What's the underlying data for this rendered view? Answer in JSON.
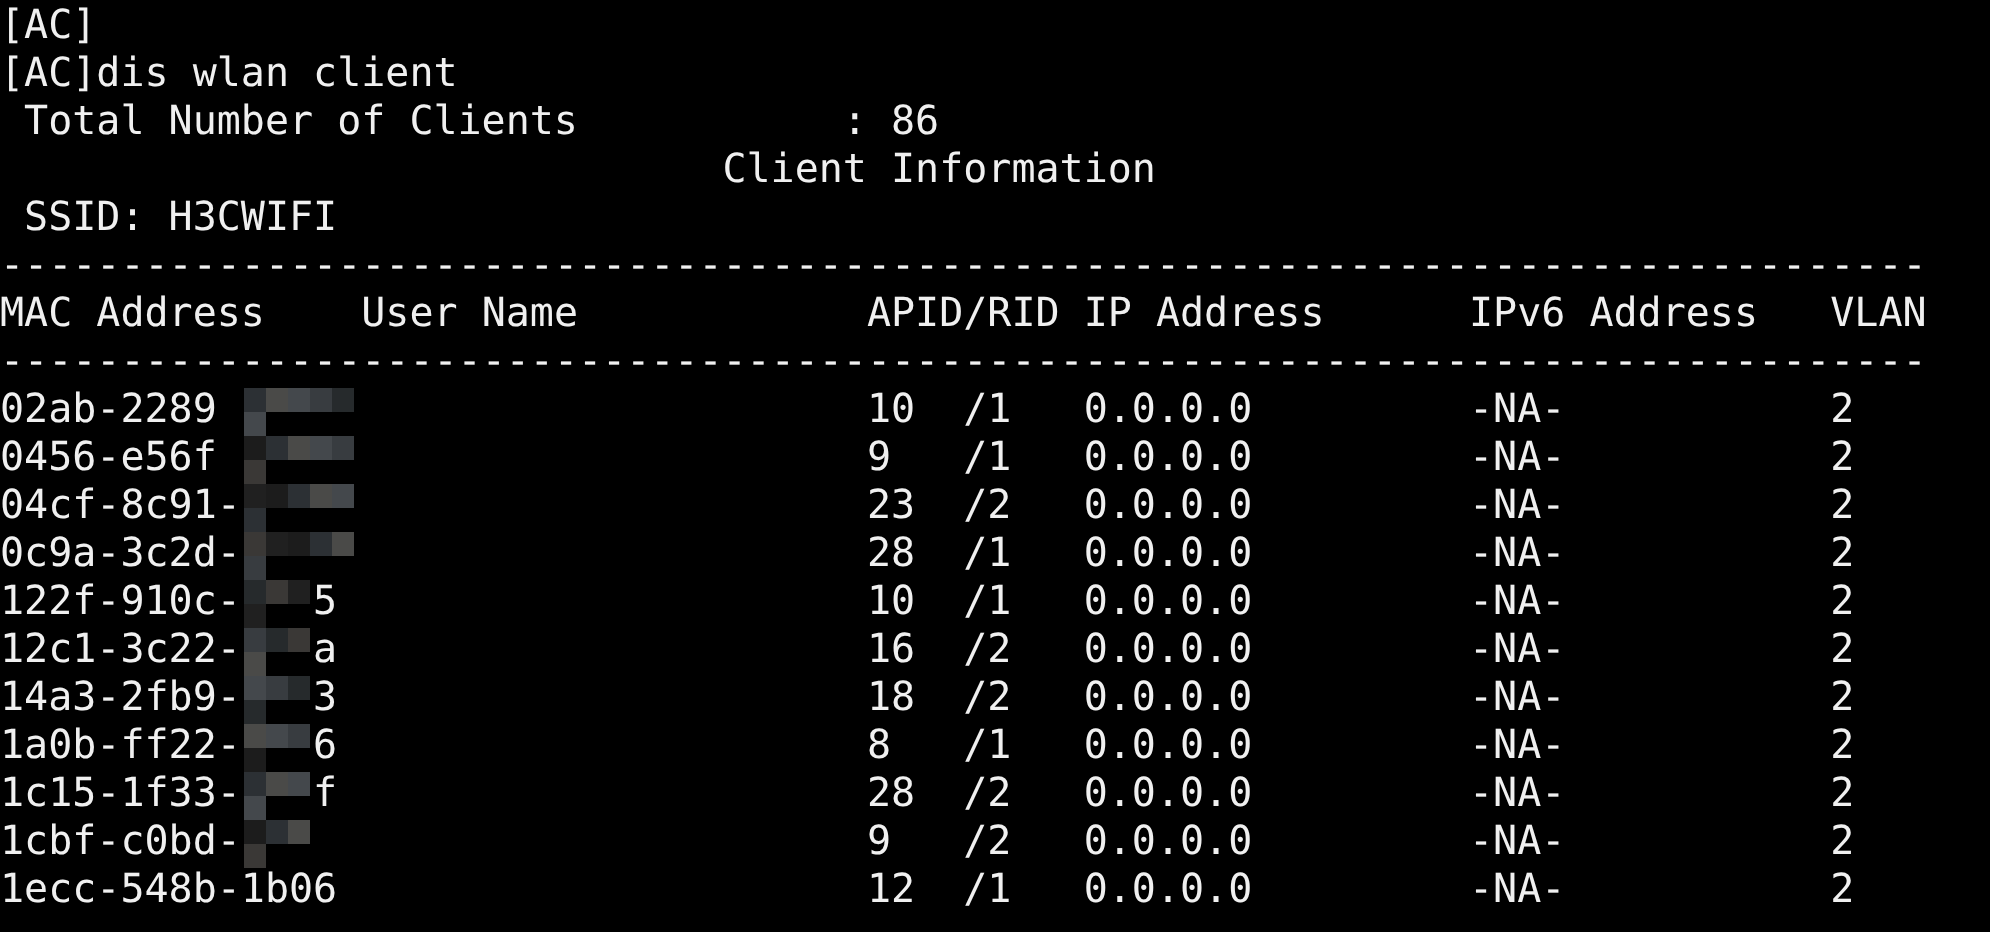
{
  "prompt_lines": [
    "[AC]",
    "[AC]dis wlan client"
  ],
  "total": {
    "label": "Total Number of Clients",
    "separator": ":",
    "value": "86"
  },
  "section_title": "Client Information",
  "ssid": "SSID: H3CWIFI",
  "rule": "--------------------------------------------------------------------------------",
  "columns": [
    "MAC Address",
    "User Name",
    "APID/RID",
    "IP Address",
    "IPv6 Address",
    "VLAN"
  ],
  "rows": [
    {
      "mac": "02ab-2289",
      "apid": "10",
      "rid": "/1",
      "ip": "0.0.0.0",
      "ipv6": "-NA-",
      "vlan": "2"
    },
    {
      "mac": "0456-e56f",
      "apid": "9",
      "rid": "/1",
      "ip": "0.0.0.0",
      "ipv6": "-NA-",
      "vlan": "2"
    },
    {
      "mac": "04cf-8c91-",
      "apid": "23",
      "rid": "/2",
      "ip": "0.0.0.0",
      "ipv6": "-NA-",
      "vlan": "2"
    },
    {
      "mac": "0c9a-3c2d-",
      "apid": "28",
      "rid": "/1",
      "ip": "0.0.0.0",
      "ipv6": "-NA-",
      "vlan": "2"
    },
    {
      "mac": "122f-910c-",
      "mac_tail": "5",
      "apid": "10",
      "rid": "/1",
      "ip": "0.0.0.0",
      "ipv6": "-NA-",
      "vlan": "2"
    },
    {
      "mac": "12c1-3c22-",
      "mac_tail": "a",
      "apid": "16",
      "rid": "/2",
      "ip": "0.0.0.0",
      "ipv6": "-NA-",
      "vlan": "2"
    },
    {
      "mac": "14a3-2fb9-",
      "mac_tail": "3",
      "apid": "18",
      "rid": "/2",
      "ip": "0.0.0.0",
      "ipv6": "-NA-",
      "vlan": "2"
    },
    {
      "mac": "1a0b-ff22-",
      "mac_tail": "6",
      "apid": "8",
      "rid": "/1",
      "ip": "0.0.0.0",
      "ipv6": "-NA-",
      "vlan": "2"
    },
    {
      "mac": "1c15-1f33-",
      "mac_tail": "f",
      "apid": "28",
      "rid": "/2",
      "ip": "0.0.0.0",
      "ipv6": "-NA-",
      "vlan": "2"
    },
    {
      "mac": "1cbf-c0bd-",
      "apid": "9",
      "rid": "/2",
      "ip": "0.0.0.0",
      "ipv6": "-NA-",
      "vlan": "2"
    },
    {
      "mac": "1ecc-548b-1b06",
      "apid": "12",
      "rid": "/1",
      "ip": "0.0.0.0",
      "ipv6": "-NA-",
      "vlan": "2"
    }
  ]
}
